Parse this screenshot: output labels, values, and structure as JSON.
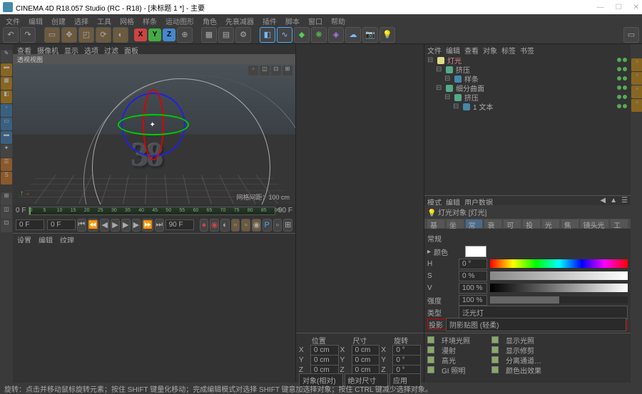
{
  "window": {
    "title": "CINEMA 4D R18.057 Studio (RC - R18) - [未标题 1 *] - 主要",
    "btns": {
      "min": "—",
      "max": "☐",
      "close": "✕"
    }
  },
  "menu": [
    "文件",
    "编辑",
    "创建",
    "选择",
    "工具",
    "网格",
    "样条",
    "运动图形",
    "角色",
    "先衰减器",
    "插件",
    "脚本",
    "窗口",
    "帮助"
  ],
  "viewport": {
    "tabs": [
      "查看",
      "摄像机",
      "显示",
      "选项",
      "过滤",
      "面板"
    ],
    "header": "透视视图",
    "hud": "网格间距：100 cm",
    "text": "38"
  },
  "timeline": {
    "start": "0 F",
    "end": "90 F",
    "cur_a": "0 F",
    "cur_b": "90 F",
    "ticks": [
      "0",
      "5",
      "10",
      "15",
      "20",
      "25",
      "30",
      "35",
      "40",
      "45",
      "50",
      "55",
      "60",
      "65",
      "70",
      "75",
      "80",
      "85",
      "90"
    ]
  },
  "hierarchy": {
    "tabs": [
      "文件",
      "编辑",
      "查看",
      "对象",
      "标签",
      "书签"
    ],
    "items": [
      {
        "indent": 0,
        "name": "灯光",
        "color": "#dd8",
        "active": true
      },
      {
        "indent": 1,
        "name": "挤压",
        "color": "#5a8"
      },
      {
        "indent": 2,
        "name": "样条",
        "color": "#48a"
      },
      {
        "indent": 1,
        "name": "细分曲面",
        "color": "#5a8"
      },
      {
        "indent": 2,
        "name": "挤压",
        "color": "#5a8"
      },
      {
        "indent": 3,
        "name": "1 文本",
        "color": "#48a"
      }
    ]
  },
  "attr": {
    "tabs": [
      "模式",
      "编辑",
      "用户数据"
    ],
    "title": "灯光对象 [灯光]",
    "subtabs": [
      "基本",
      "坐标",
      "常规",
      "衰减",
      "可见",
      "投影",
      "光度",
      "焦散",
      "镜头光晕",
      "工程"
    ],
    "section": "常规",
    "color_label": "颜色",
    "h": {
      "lbl": "H",
      "val": "0 °"
    },
    "s": {
      "lbl": "S",
      "val": "0 %"
    },
    "v": {
      "lbl": "V",
      "val": "100 %"
    },
    "intensity": {
      "lbl": "强度",
      "val": "100 %"
    },
    "type": {
      "lbl": "类型",
      "val": "泛光灯"
    },
    "shadow": {
      "lbl": "投影",
      "val": "阴影贴图 (轻柔)"
    }
  },
  "coords": {
    "tabs": [
      "位置",
      "尺寸",
      "旋转"
    ],
    "rows": [
      {
        "axis": "X",
        "p": "0 cm",
        "s": "0 cm",
        "r": "0 °"
      },
      {
        "axis": "Y",
        "p": "0 cm",
        "s": "0 cm",
        "r": "0 °"
      },
      {
        "axis": "Z",
        "p": "0 cm",
        "s": "0 cm",
        "r": "0 °"
      }
    ],
    "mode_a": "对象(相对)",
    "mode_b": "绝对尺寸",
    "apply": "应用"
  },
  "shadow_opts": {
    "rows": [
      [
        "环境光照",
        "",
        "显示光照"
      ],
      [
        "漫射",
        "",
        "显示修剪"
      ],
      [
        "高光",
        "",
        "分离通道…"
      ],
      [
        "GI 照明",
        "",
        "颜色出效果"
      ]
    ]
  },
  "lower_tabs": [
    "设置",
    "编辑",
    "纹理"
  ],
  "status": [
    "旋转：点击并移动鼠标旋转元素；按住 SHIFT 键量化移动；完成编辑模式对选择 SHIFT 键意加选择对象；按住 CTRL 键减少选择对象。"
  ]
}
